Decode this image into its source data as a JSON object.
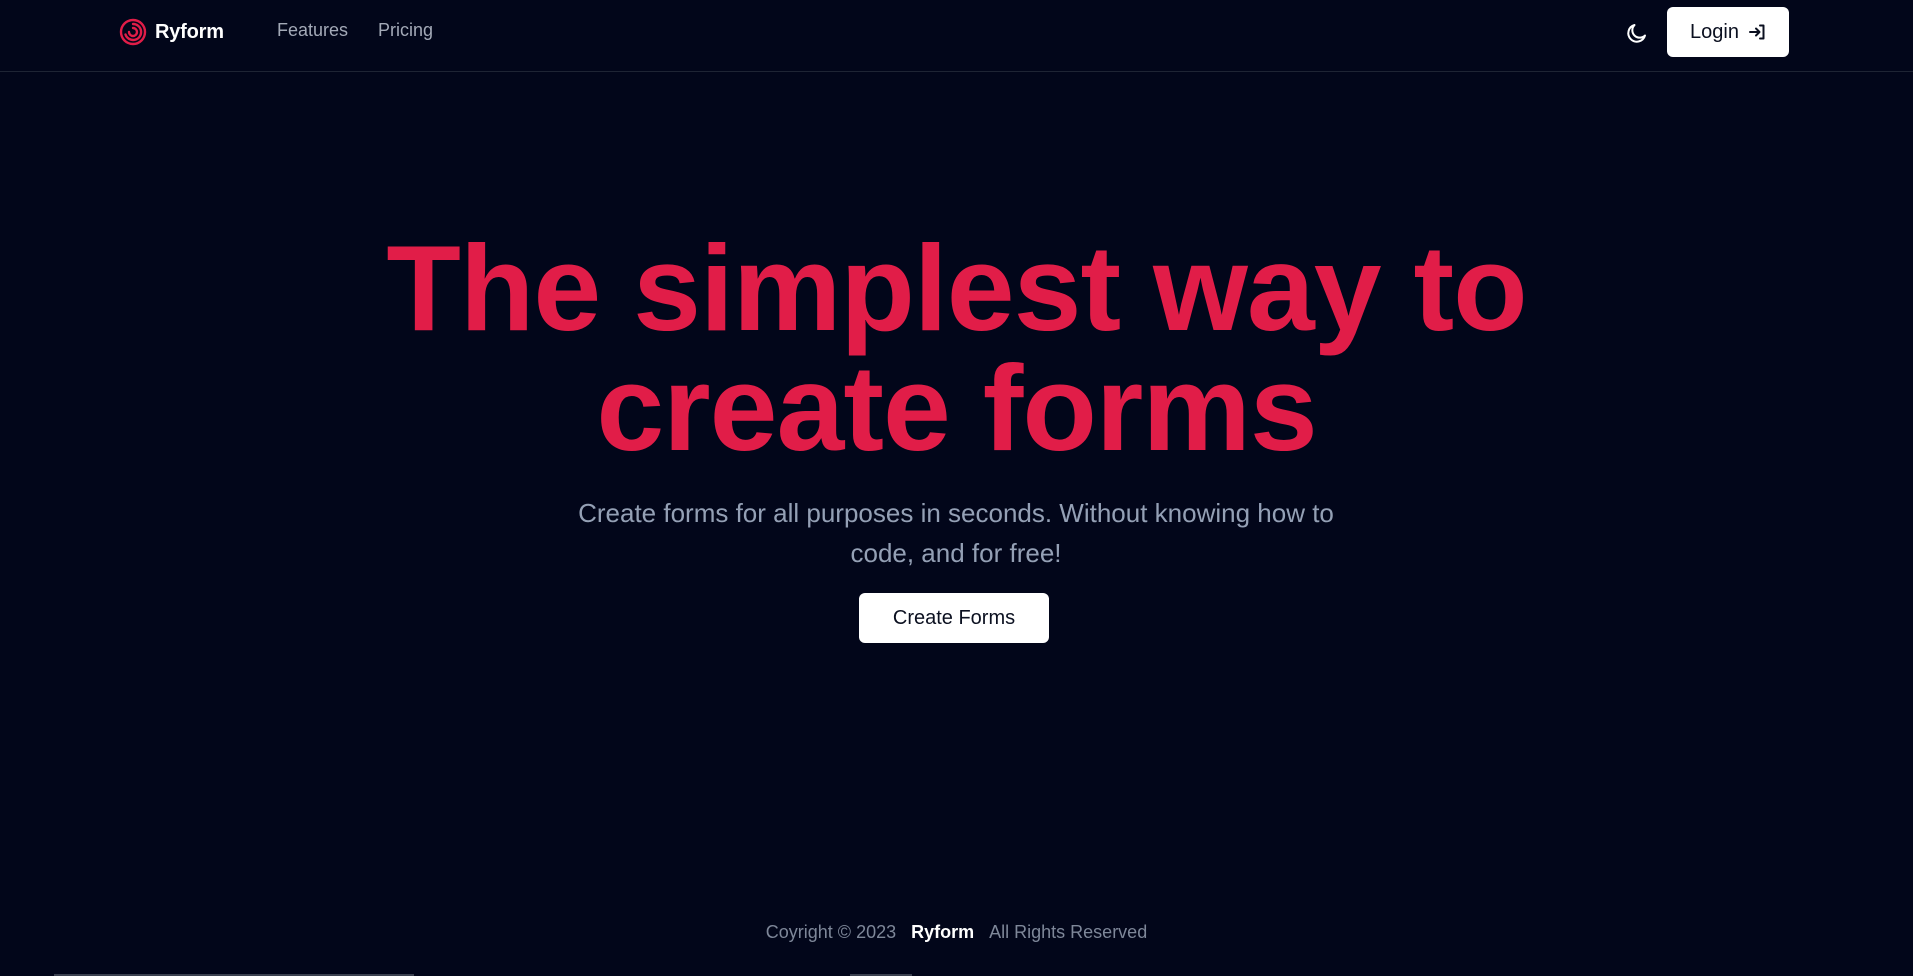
{
  "header": {
    "brand_name": "Ryform",
    "brand_icon": "spiral-logo-icon",
    "nav": [
      {
        "label": "Features"
      },
      {
        "label": "Pricing"
      }
    ],
    "theme_toggle_icon": "moon-icon",
    "login_label": "Login",
    "login_icon": "sign-in-icon"
  },
  "hero": {
    "title_line1": "The simplest way to",
    "title_line2": "create forms",
    "subtitle": "Create forms for all purposes in seconds. Without knowing how to code, and for free!",
    "cta_label": "Create Forms"
  },
  "footer": {
    "copyright": "Coyright © 2023",
    "brand": "Ryform",
    "rights": "All Rights Reserved"
  },
  "colors": {
    "background": "#02061a",
    "accent": "#e11d48",
    "button_bg": "#ffffff",
    "muted_text": "#94a0b5"
  }
}
